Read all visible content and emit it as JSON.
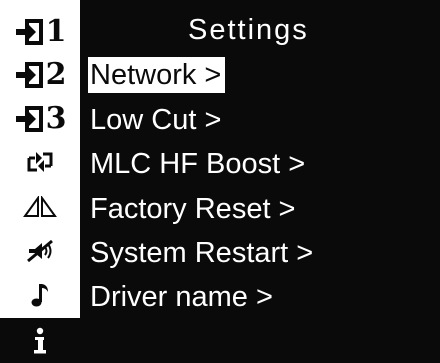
{
  "header": {
    "title": "Settings"
  },
  "sidebar": {
    "icons": [
      {
        "name": "input-1-icon",
        "number": "1"
      },
      {
        "name": "input-2-icon",
        "number": "2"
      },
      {
        "name": "input-3-icon",
        "number": "3"
      },
      {
        "name": "linked-arrows-icon"
      },
      {
        "name": "polarity-triangles-icon"
      },
      {
        "name": "mute-speaker-icon"
      },
      {
        "name": "music-note-icon"
      },
      {
        "name": "info-icon",
        "selected": true
      }
    ]
  },
  "menu": {
    "items": [
      {
        "label": "Network >",
        "highlighted": true
      },
      {
        "label": "Low Cut >"
      },
      {
        "label": "MLC HF Boost >"
      },
      {
        "label": "Factory Reset >"
      },
      {
        "label": "System Restart >"
      },
      {
        "label": "Driver name >"
      }
    ]
  },
  "colors": {
    "background": "#0a0a0a",
    "foreground": "#ffffff"
  }
}
